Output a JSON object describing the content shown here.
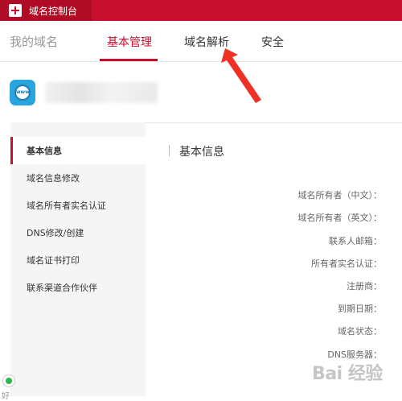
{
  "app": {
    "title": "域名控制台"
  },
  "nav": {
    "my_domains": "我的域名",
    "tabs": [
      {
        "label": "基本管理",
        "active": true
      },
      {
        "label": "域名解析",
        "active": false
      },
      {
        "label": "安全",
        "active": false
      }
    ]
  },
  "domain_header": {
    "icon_text": "www"
  },
  "sidebar": {
    "items": [
      {
        "label": "基本信息",
        "active": true
      },
      {
        "label": "域名信息修改"
      },
      {
        "label": "域名所有者实名认证"
      },
      {
        "label": "DNS修改/创建"
      },
      {
        "label": "域名证书打印"
      },
      {
        "label": "联系渠道合作伙伴"
      }
    ]
  },
  "main": {
    "title": "基本信息",
    "fields": [
      "域名所有者（中文）：",
      "域名所有者（英文）：",
      "联系人邮箱：",
      "所有者实名认证：",
      "注册商：",
      "到期日期：",
      "域名状态：",
      "DNS服务器："
    ]
  },
  "watermark": {
    "text": "Bai 经验"
  },
  "corner": {
    "text": "好"
  },
  "colors": {
    "brand_red": "#c8102e",
    "www_blue": "#29a6e0",
    "status_green": "#2db84d"
  }
}
